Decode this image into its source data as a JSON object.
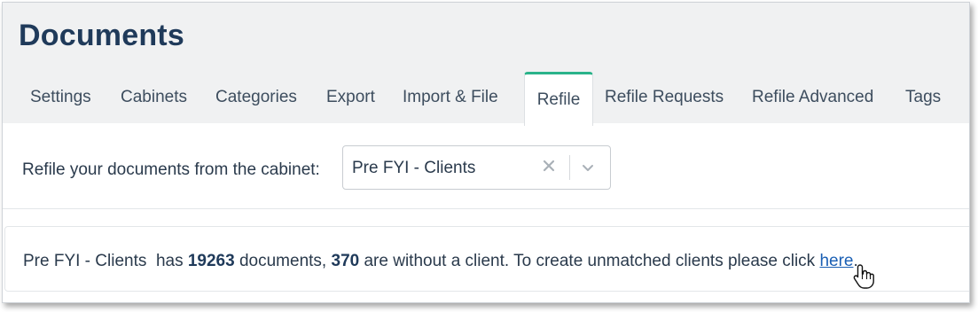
{
  "page": {
    "title": "Documents"
  },
  "tabs": [
    {
      "label": "Settings"
    },
    {
      "label": "Cabinets"
    },
    {
      "label": "Categories"
    },
    {
      "label": "Export"
    },
    {
      "label": "Import & File"
    },
    {
      "label": "Refile",
      "active": true
    },
    {
      "label": "Refile Requests"
    },
    {
      "label": "Refile Advanced"
    },
    {
      "label": "Tags"
    }
  ],
  "refile": {
    "label": "Refile your documents from the cabinet:",
    "selected_cabinet": "Pre FYI - Clients"
  },
  "info": {
    "cabinet_name": "Pre FYI - Clients",
    "has_text": "has",
    "document_count": "19263",
    "documents_text": "documents,",
    "without_client_count": "370",
    "without_text": "are without a client. To create unmatched clients please click",
    "link_label": "here",
    "end_punct": "."
  },
  "icons": {
    "clear": "close-icon",
    "dropdown": "chevron-down-icon",
    "cursor": "hand-pointer-icon"
  },
  "colors": {
    "accent_tab": "#2bb38a",
    "title": "#1f3a5a",
    "link": "#1a5fb4",
    "header_bg": "#f0f1f2"
  }
}
